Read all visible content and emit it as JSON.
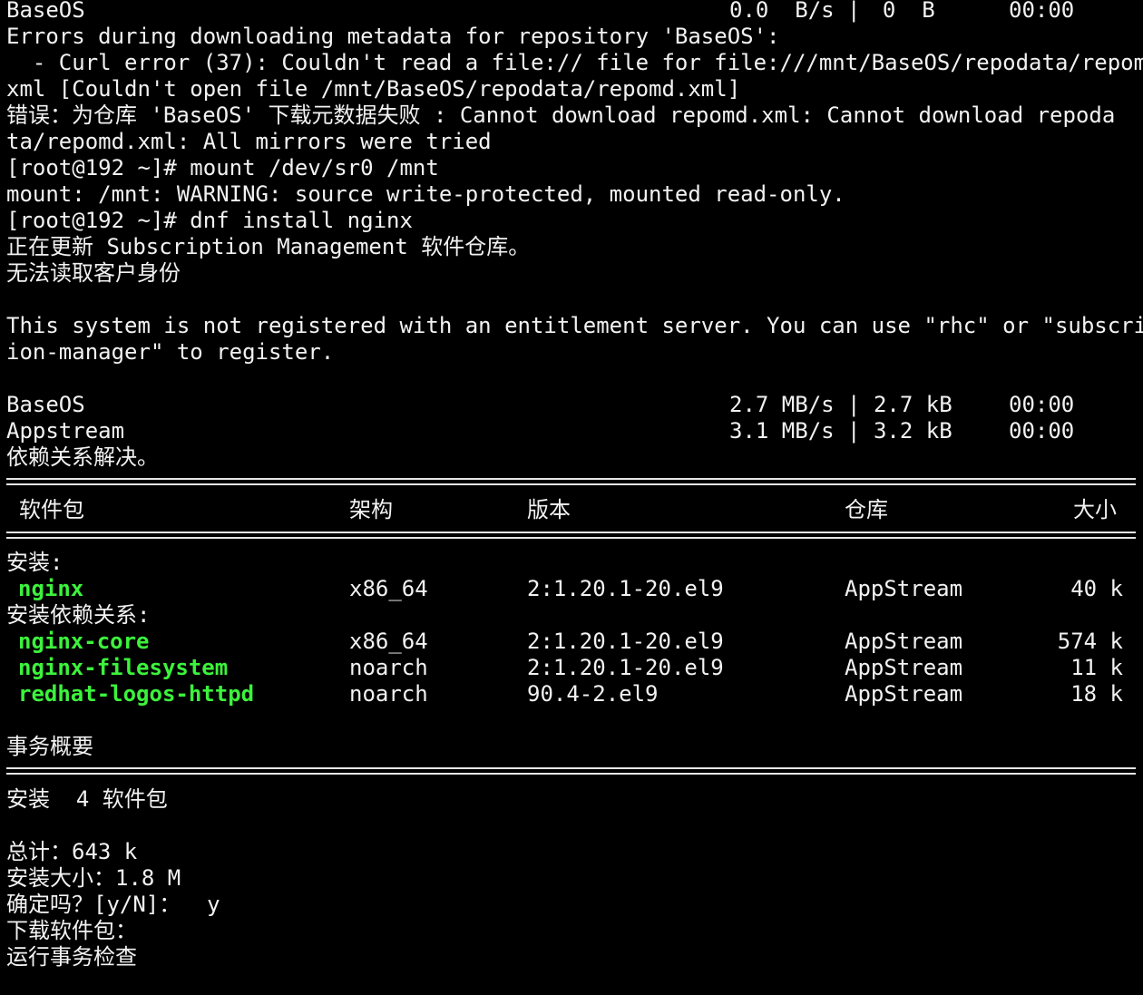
{
  "top_progress": {
    "repo": "BaseOS",
    "speed": "0.0  B/s | ",
    "size": "  0  B",
    "time": "00:00"
  },
  "errors": {
    "line1": "Errors during downloading metadata for repository 'BaseOS':",
    "line2": "  - Curl error (37): Couldn't read a file:// file for file:///mnt/BaseOS/repodata/repomd.",
    "line3": "xml [Couldn't open file /mnt/BaseOS/repodata/repomd.xml]",
    "line4": "错误：为仓库 'BaseOS' 下载元数据失败 : Cannot download repomd.xml: Cannot download repoda",
    "line5": "ta/repomd.xml: All mirrors were tried"
  },
  "commands": {
    "mount_cmd": "[root@192 ~]# mount /dev/sr0 /mnt",
    "mount_warning": "mount: /mnt: WARNING: source write-protected, mounted read-only.",
    "dnf_cmd": "[root@192 ~]# dnf install nginx"
  },
  "subscription": {
    "updating": "正在更新 Subscription Management 软件仓库。",
    "no_identity": "无法读取客户身份",
    "notice1": "This system is not registered with an entitlement server. You can use \"rhc\" or \"subscript",
    "notice2": "ion-manager\" to register."
  },
  "repos": [
    {
      "name": "BaseOS",
      "speed": "2.7 MB/s | 2.7 kB",
      "time": "00:00"
    },
    {
      "name": "Appstream",
      "speed": "3.1 MB/s | 3.2 kB",
      "time": "00:00"
    }
  ],
  "resolved": "依赖关系解决。",
  "table": {
    "headers": {
      "package": "软件包",
      "arch": "架构",
      "version": "版本",
      "repo": "仓库",
      "size": "大小"
    },
    "install_section": "安装:",
    "deps_section": "安装依赖关系:",
    "install_rows": [
      {
        "name": "nginx",
        "arch": "x86_64",
        "version": "2:1.20.1-20.el9",
        "repo": "AppStream",
        "size": "40 k"
      }
    ],
    "dep_rows": [
      {
        "name": "nginx-core",
        "arch": "x86_64",
        "version": "2:1.20.1-20.el9",
        "repo": "AppStream",
        "size": "574 k"
      },
      {
        "name": "nginx-filesystem",
        "arch": "noarch",
        "version": "2:1.20.1-20.el9",
        "repo": "AppStream",
        "size": "11 k"
      },
      {
        "name": "redhat-logos-httpd",
        "arch": "noarch",
        "version": "90.4-2.el9",
        "repo": "AppStream",
        "size": "18 k"
      }
    ]
  },
  "summary": {
    "title": "事务概要",
    "install_count": "安装  4 软件包",
    "total": "总计：643 k",
    "installed_size": "安装大小：1.8 M",
    "confirm": "确定吗？[y/N]：  y",
    "downloading": "下载软件包：",
    "running_check": "运行事务检查"
  },
  "colors": {
    "background": "#000000",
    "text": "#f2f2f2",
    "package_name": "#3cf23c"
  }
}
